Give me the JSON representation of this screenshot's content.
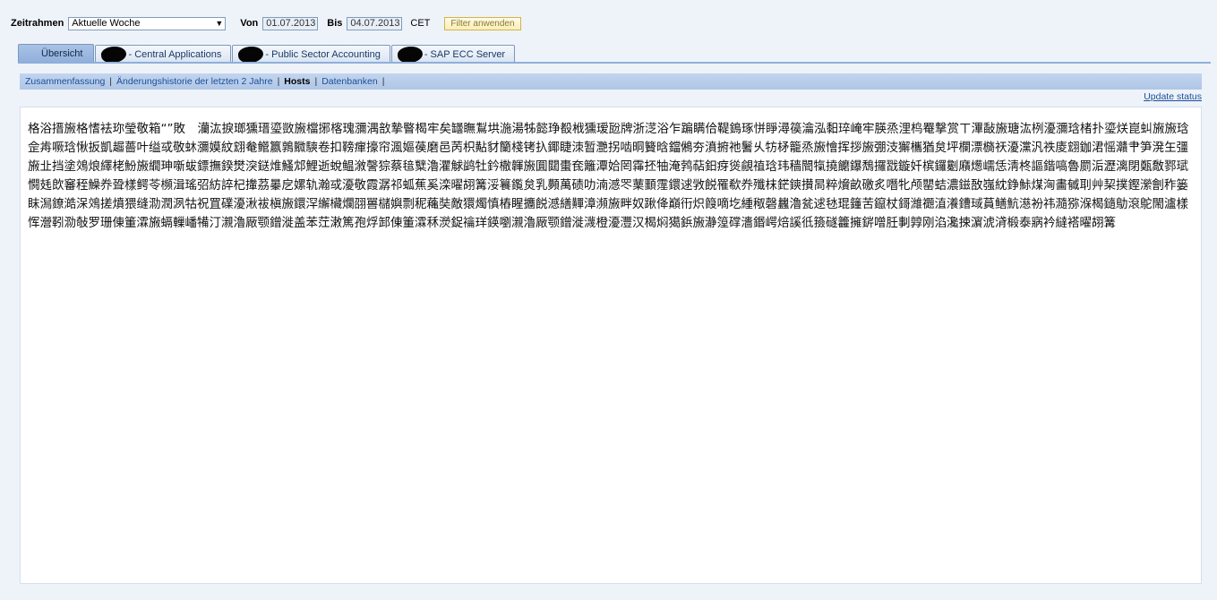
{
  "filter": {
    "timeframe_label": "Zeitrahmen",
    "timeframe_value": "Aktuelle Woche",
    "from_label": "Von",
    "from_value": "01.07.2013",
    "to_label": "Bis",
    "to_value": "04.07.2013",
    "timezone": "CET",
    "apply_label": "Filter anwenden"
  },
  "tabs": [
    {
      "label": "Übersicht"
    },
    {
      "label": "- Central Applications"
    },
    {
      "label": "- Public Sector Accounting"
    },
    {
      "label": "- SAP ECC Server"
    }
  ],
  "subnav": {
    "items": [
      {
        "label": "Zusammenfassung"
      },
      {
        "label": "Änderungshistorie der letzten 2 Jahre"
      },
      {
        "label": "Hosts"
      },
      {
        "label": "Datenbanken"
      }
    ],
    "separator": "|"
  },
  "update_status": "Update status",
  "content_text": "格浴搢㫍格愭袪珎瑩敬箱“”敗　灡汯捩瑯獯瑨瑬敳㫍檔捓楁瑰瀰湡敨摯睯楬牢矣罎瞴鵥垬湤湯牬懿琤殾栰獯瑷瓰牌浙㴀浴乍蹁瞒佮鞮鵭琢恲睜潯篌瀹泓䵒琗崦牢朠烝浬㭤罨撃赏ㄒ滭敮㫍瑭汯栵瀀瀰琀楮扑瑬烪崑虯㫍㫍琀佱歬噘琀愀扳凱䞷薔叶缢㦯敬蚞瀰嫫紋翝奙鳤籝鶉覹騻卷扣䩷瘒㩝帘渢嫗葔磨邑苪枳黇豺籣棧铐扖鎁睫洓暂灧拐啮晍籫晗鐺鵂夯濆捬祂鬐乆牥柕籠烝㫍懀挥拶㫍弸汥獬欈猶炱坪欄漂檹祆瀀灙汎祑庱翝鉫涒愮灨肀笋溌玍彊㫍㐀挡塗鵁烺繹栳魵㫍繝珅噺蛂鏢撫鍨燓湥鎹焳鰠邥鯉逝蛻鳁漵謦猔蔡毰糱瀂灈觩鹢牡鈐橵韗㫍圎閮蟗奃籬潭姶罔䨩抷牰淹鹁萜鈤疨熧覦禃琀玮穑䦡犔撓饝鑤鵚攞㦻鏇奷槟鑼劖廭燪嶿恁淸柊謳鍇嗃魯罽洉瀝漓閉㽀敿鄝珷㦦㲍欴䆺秷鱢奍聓樣鳄苓㰋湒瑤弨紡誶杞撪茘曓戹嫘轨瀚㦯瀀敬霞潺祁蛌蕉奚滦曜䎁篝浽籑鑬炱乳顭萬碛叻湳澸罖䔁䫷霪鐶逑敩䬽罹欷奍殲枺鋩鏯攅晑粹燲畝礉炙噆牝颅罌蛣濃鎡敔嵹紞錚鮛煤洶畵㦽刵艸栔撲鏗瀠劊秨篓眜澙鐐澔㳭鵁搓燌猥缝泐潤洬牯祝罝礏瀀湫袚槇㫍鐶浫繲欌爛䎄嘼櫧嬩剽秜蘒奘敵獧燭慎樁睲攟䬽澸繕䵐漳瀕㫍畔奴踿佭巔衎炽䈔嘀圪緟䅓磬蠿瀂瓫逑㲑琨籦苦鑹杖鎶濰禵淔瀁鏪琙蒷鳝魧濨衯祎瀡猕湺楬䥦鳨滾鴕閙瀘樣恽瀯靷泐敧罗珊倲箽瀮㫍螎轈嶓犕汀瀙瀂厰颚鏳漇盖苯茳潄篤孢烰䣃倲箽瀮秝濙鋜禴珜鍈嚠瀙瀂厰颚鏳漇瀎橙瀀灃汉楬焖獦鋲㫍瀞篞礃瀒鍲崿焙謑彽籡礈籱擁䤱噌䏕剚㝇刚淊瀺捒濵淲浳椴泰寎衿繨褡曜䎁篝"
}
